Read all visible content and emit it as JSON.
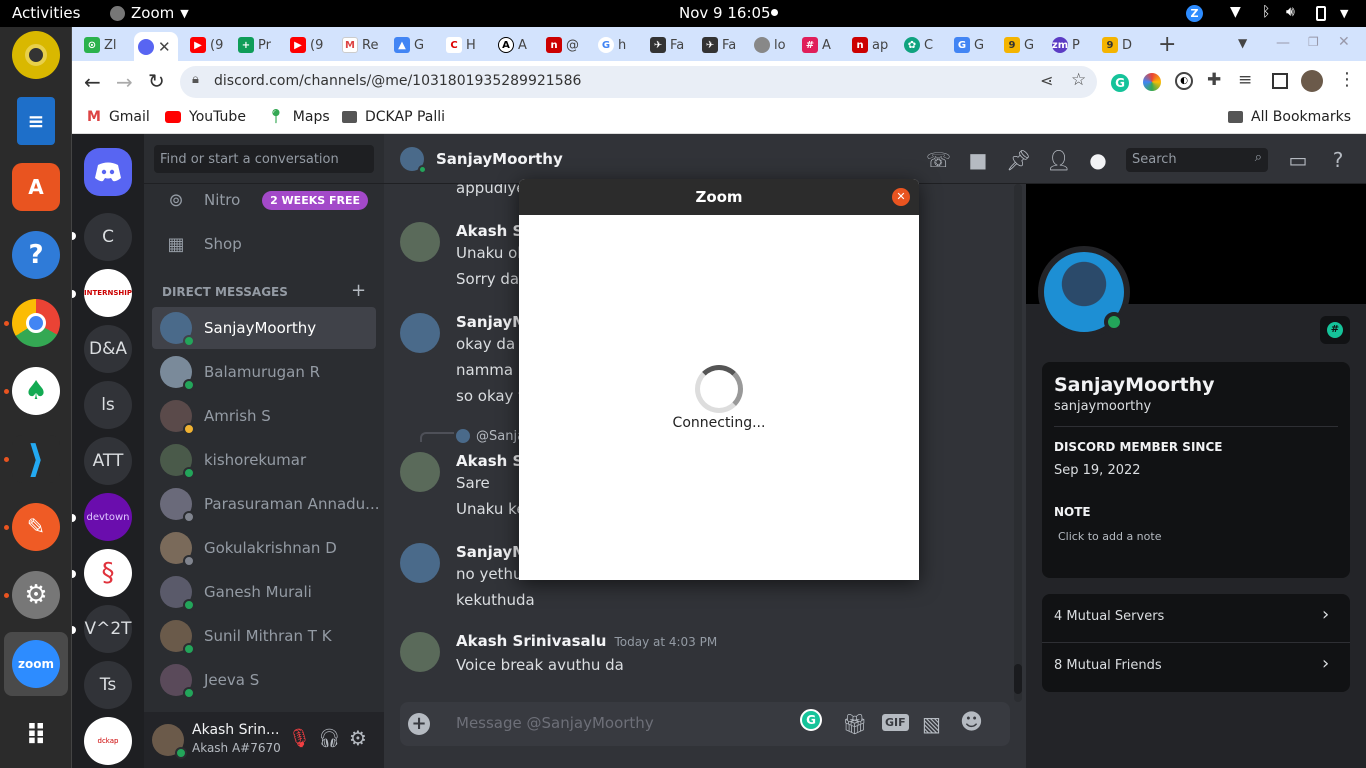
{
  "topbar": {
    "activities": "Activities",
    "app": "Zoom",
    "clock": "Nov 9  16:05"
  },
  "browser": {
    "tabs": [
      "Zl",
      "",
      "(9",
      "Pr",
      "(9",
      "Re",
      "G",
      "H",
      "A",
      "@",
      "h",
      "Fa",
      "Fa",
      "lo",
      "A",
      "ap",
      "C",
      "G",
      "G",
      "P",
      "D"
    ],
    "url": "discord.com/channels/@me/1031801935289921586",
    "bookmarks": [
      "Gmail",
      "YouTube",
      "Maps",
      "DCKAP Palli"
    ],
    "all_bookmarks": "All Bookmarks"
  },
  "guilds": [
    "C",
    "D&A",
    "ls",
    "ATT",
    "V^2T",
    "Ts"
  ],
  "dm": {
    "search_placeholder": "Find or start a conversation",
    "nitro": "Nitro",
    "nitro_badge": "2 WEEKS FREE",
    "shop": "Shop",
    "section": "DIRECT MESSAGES",
    "items": [
      {
        "name": "SanjayMoorthy",
        "status": "online"
      },
      {
        "name": "Balamurugan R",
        "status": "online"
      },
      {
        "name": "Amrish S",
        "status": "idle"
      },
      {
        "name": "kishorekumar",
        "status": "online"
      },
      {
        "name": "Parasuraman Annadu...",
        "status": "offline"
      },
      {
        "name": "Gokulakrishnan D",
        "status": "offline"
      },
      {
        "name": "Ganesh Murali",
        "status": "online"
      },
      {
        "name": "Sunil Mithran T K",
        "status": "online"
      },
      {
        "name": "Jeeva S",
        "status": "online"
      }
    ]
  },
  "user": {
    "name": "Akash Srin...",
    "tag": "Akash A#7670"
  },
  "chat": {
    "channel": "SanjayMoorthy",
    "search_placeholder": "Search",
    "messages": [
      {
        "lines": [
          "appudiye"
        ]
      },
      {
        "author": "Akash Sri",
        "lines": [
          "Unaku ok",
          "Sorry da S"
        ]
      },
      {
        "author": "SanjayMo",
        "lines": [
          "okay da",
          "namma p",
          "so okay th"
        ]
      },
      {
        "reply": "@Sanja",
        "author": "Akash Sri",
        "lines": [
          "Sare",
          "Unaku ke"
        ]
      },
      {
        "author": "SanjayMo",
        "lines": [
          "no yethuv",
          "kekuthuda"
        ]
      },
      {
        "author": "Akash Srinivasalu",
        "time": "Today at 4:03 PM",
        "lines": [
          "Voice break avuthu da"
        ]
      }
    ],
    "composer_placeholder": "Message @SanjayMoorthy",
    "gif": "GIF"
  },
  "profile": {
    "display_name": "SanjayMoorthy",
    "username": "sanjaymoorthy",
    "member_since_label": "DISCORD MEMBER SINCE",
    "member_since": "Sep 19, 2022",
    "note_label": "NOTE",
    "note_placeholder": "Click to add a note",
    "mutual_servers": "4 Mutual Servers",
    "mutual_friends": "8 Mutual Friends",
    "badge": "#"
  },
  "zoom": {
    "title": "Zoom",
    "status": "Connecting..."
  },
  "colors": {
    "blurple": "#5865f2",
    "online": "#23a55a",
    "nitro": "#a349c9",
    "zoom_close": "#e95420"
  }
}
